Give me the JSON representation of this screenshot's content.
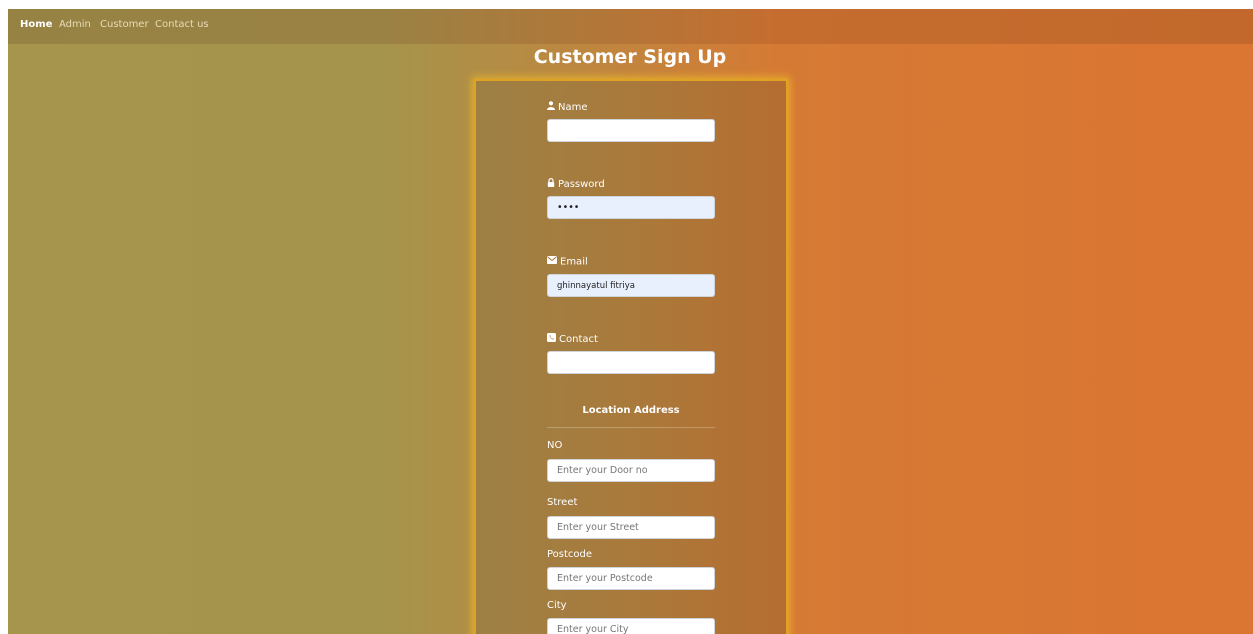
{
  "nav": {
    "links": [
      "Home",
      "Admin",
      "Customer",
      "Contact us"
    ]
  },
  "page": {
    "title": "Customer Sign Up"
  },
  "form": {
    "name_label": "Name",
    "name_value": "",
    "password_label": "Password",
    "password_value": "••••",
    "email_label": "Email",
    "email_value": "ghinnayatul fitriya",
    "contact_label": "Contact",
    "contact_value": ""
  },
  "address": {
    "section_title": "Location Address",
    "no_label": "NO",
    "no_placeholder": "Enter your Door no",
    "street_label": "Street",
    "street_placeholder": "Enter your Street",
    "postcode_label": "Postcode",
    "postcode_placeholder": "Enter your Postcode",
    "city_label": "City",
    "city_placeholder": "Enter your City"
  },
  "colors": {
    "panel_border": "#e0a224",
    "background_left": "#a5954d",
    "background_right": "#db7532",
    "autofill": "#e8f0fe"
  },
  "icons": {
    "name": "user-icon",
    "password": "lock-icon",
    "email": "envelope-icon",
    "contact": "phone-icon"
  }
}
